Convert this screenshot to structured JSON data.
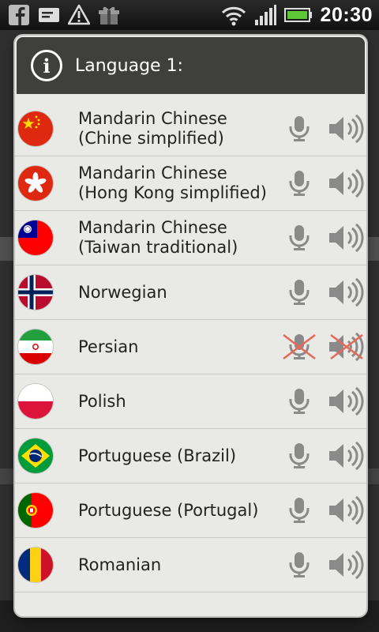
{
  "status_bar": {
    "time": "20:30",
    "left_icons": [
      "facebook-icon",
      "message-icon",
      "warning-icon",
      "gift-icon"
    ],
    "right_icons": [
      "wifi-icon",
      "signal-icon",
      "battery-icon"
    ]
  },
  "dialog": {
    "title": "Language 1:",
    "icon": "info-icon"
  },
  "languages": [
    {
      "line1": "Mandarin Chinese",
      "line2": "(Chine simplified)",
      "flag": "china-flag-icon",
      "tts": true
    },
    {
      "line1": "Mandarin Chinese",
      "line2": "(Hong Kong simplified)",
      "flag": "hong-kong-flag-icon",
      "tts": true
    },
    {
      "line1": "Mandarin Chinese",
      "line2": "(Taiwan traditional)",
      "flag": "taiwan-flag-icon",
      "tts": true
    },
    {
      "line1": "Norwegian",
      "line2": "",
      "flag": "norway-flag-icon",
      "tts": true
    },
    {
      "line1": "Persian",
      "line2": "",
      "flag": "iran-flag-icon",
      "tts": false
    },
    {
      "line1": "Polish",
      "line2": "",
      "flag": "poland-flag-icon",
      "tts": true
    },
    {
      "line1": "Portuguese (Brazil)",
      "line2": "",
      "flag": "brazil-flag-icon",
      "tts": true
    },
    {
      "line1": "Portuguese (Portugal)",
      "line2": "",
      "flag": "portugal-flag-icon",
      "tts": true
    },
    {
      "line1": "Romanian",
      "line2": "",
      "flag": "romania-flag-icon",
      "tts": true
    }
  ],
  "colors": {
    "dialog_bg": "#e9e9e5",
    "header_bg": "#3f3f3c",
    "icon_gray": "#8a8a8a",
    "unavailable_cross": "#e36a5a"
  }
}
